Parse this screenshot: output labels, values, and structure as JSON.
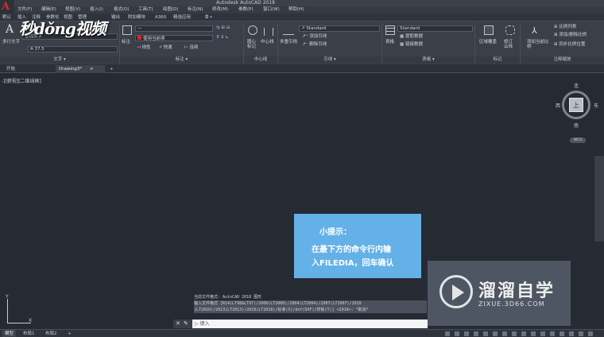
{
  "window": {
    "title": "Autodesk AutoCAD 2018"
  },
  "menu": [
    "文件(F)",
    "编辑(E)",
    "视图(V)",
    "插入(I)",
    "格式(O)",
    "工具(T)",
    "绘图(D)",
    "标注(N)",
    "修改(M)",
    "参数(P)",
    "窗口(W)",
    "帮助(H)"
  ],
  "ribbon_tabs": [
    "默认",
    "插入",
    "注释",
    "参数化",
    "视图",
    "管理",
    "输出",
    "附加模块",
    "A360",
    "精选应用"
  ],
  "watermark": "秒dǒng视频",
  "ribbon": {
    "multiline_text": "多行文字",
    "find_text": "查找文字",
    "text_height": "37.5",
    "dimension": "标注",
    "layer_current": "使用当前项",
    "linear": "线性",
    "quick": "快速",
    "continue": "连续",
    "center_mark": "圆心标记",
    "centerline": "中心线",
    "multileader": "多重引线",
    "leader_style": "Standard",
    "add_leader": "添加引线",
    "remove_leader": "删除引线",
    "table": "表格",
    "table_style": "Standard",
    "extract_data": "提取数据",
    "link_data": "链接数据",
    "revcloud": "区域覆盖",
    "revcloud2": "修订云线",
    "add_scale": "添加当前比例",
    "scale_list": "比例列表",
    "add_delete_scale": "添加/删除比例",
    "sync_scale": "同步比例位置",
    "panels": {
      "text": "文字 ▾",
      "annotation": "标注 ▾",
      "centerline": "中心线",
      "leader": "引线 ▾",
      "table": "表格 ▾",
      "markup": "标记",
      "scale": "注释缩放"
    }
  },
  "doc_tabs": [
    "开始",
    "Drawing3*"
  ],
  "view_label": "-][俯视][二维线框]",
  "viewcube": {
    "top": "上",
    "north": "北",
    "south": "南",
    "east": "东",
    "west": "西",
    "wcs": "WCS"
  },
  "tip": {
    "title": "小提示：",
    "line1": "在最下方的命令行内输",
    "line2": "入FILEDIA，回车确认"
  },
  "brand": {
    "name": "溜溜自学",
    "url": "ZIXUE.3D66.COM"
  },
  "command_history": [
    "当前文件格式: AutoCAD 2018 图形",
    "输入文件格式 [R14(LT98&LT97)/2000(LT2000)/2004(LT2004)/2007(LT2007)/2010",
    "(LT2010)/2013(LT2013)/2018(LT2018)/标准(S)/dxf(DXF)/样板(T)] <2018>: *取消*"
  ],
  "command_input_placeholder": "键入",
  "ucs": {
    "x": "X",
    "y": "Y"
  },
  "layout_tabs": [
    "模型",
    "布局1",
    "布局2"
  ]
}
